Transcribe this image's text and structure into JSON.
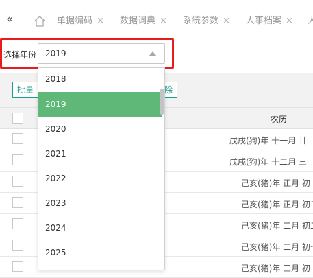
{
  "tabbar": {
    "collapse_glyph": "«",
    "tabs": [
      {
        "label": "单据编码",
        "close": "×"
      },
      {
        "label": "数据词典",
        "close": "×"
      },
      {
        "label": "系统参数",
        "close": "×"
      },
      {
        "label": "人事档案",
        "close": "×"
      },
      {
        "label": "人",
        "close": ""
      }
    ]
  },
  "filter": {
    "year_label": "选择年份",
    "selected_year": "2019"
  },
  "toolbar": {
    "batch_label": "批量",
    "delete_label": "除"
  },
  "table": {
    "lunar_header": "农历",
    "rows": [
      "戊戌(狗)年 十一月 廿",
      "戊戌(狗)年 十二月 三",
      "己亥(猪)年 正月 初一",
      "己亥(猪)年 正月 初二",
      "己亥(猪)年 二月 初二",
      "己亥(猪)年 二月 初七",
      "己亥(猪)年 三月 初一"
    ]
  },
  "dropdown": {
    "options": [
      "2018",
      "2019",
      "2020",
      "2021",
      "2022",
      "2023",
      "2024",
      "2025"
    ],
    "selected": "2019"
  },
  "colors": {
    "accent_green": "#5fb878",
    "teal": "#1e9e8a",
    "highlight_red": "#e81c1c"
  }
}
